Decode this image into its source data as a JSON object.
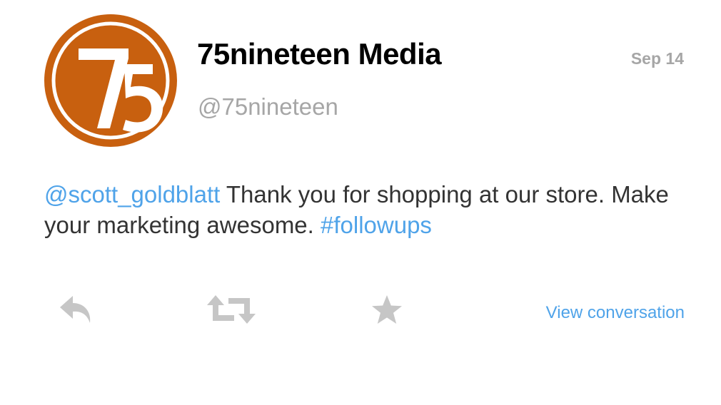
{
  "tweet": {
    "author_name": "75nineteen Media",
    "author_handle": "@75nineteen",
    "timestamp": "Sep 14",
    "mention": "@scott_goldblatt",
    "text_part1": " Thank you for shopping at our store. Make your marketing awesome. ",
    "hashtag": "#followups"
  },
  "avatar": {
    "logo_text": "75",
    "logo_color": "#c8600f"
  },
  "actions": {
    "reply_icon": "reply-icon",
    "retweet_icon": "retweet-icon",
    "favorite_icon": "star-icon",
    "view_conversation_label": "View conversation"
  },
  "colors": {
    "link": "#4fa3e9",
    "secondary_text": "#a6a6a6",
    "icon": "#c6c6c6"
  }
}
